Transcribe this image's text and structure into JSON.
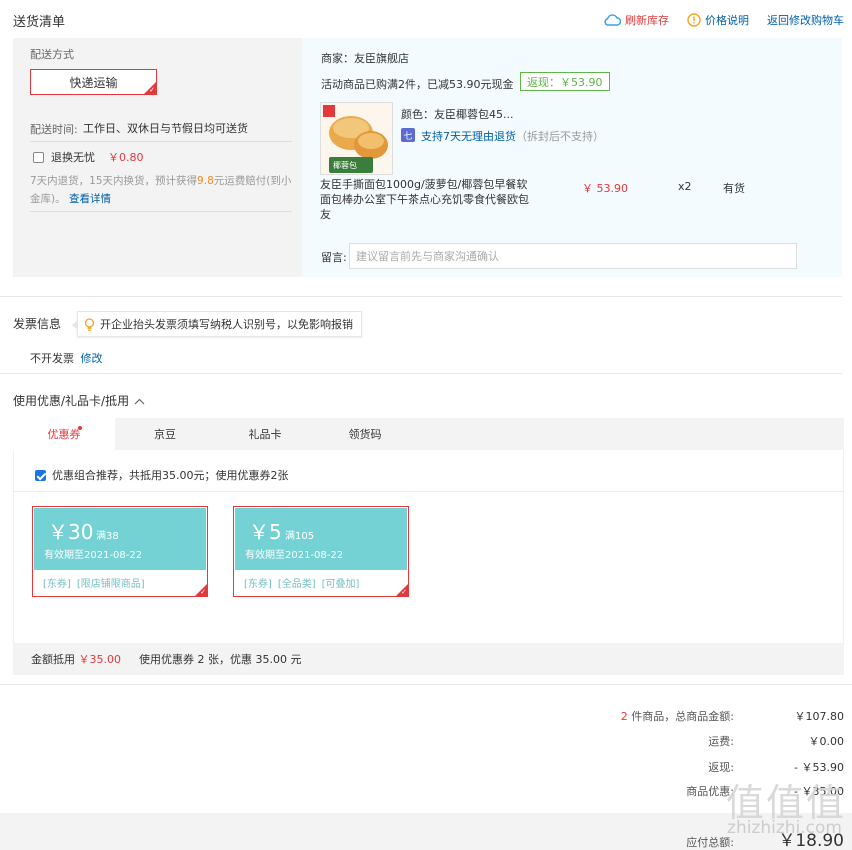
{
  "header": {
    "title": "送货清单",
    "links": [
      {
        "label": "刷新库存",
        "color": "#e4393c",
        "icon": "cloud-refresh-icon"
      },
      {
        "label": "价格说明",
        "color": "#005ea7",
        "icon": "info-circle-icon"
      },
      {
        "label": "返回修改购物车",
        "color": "#005ea7"
      }
    ]
  },
  "shipping": {
    "method_label": "配送方式",
    "method_value": "快递运输",
    "time_label": "配送时间:",
    "time_value": "工作日、双休日与节假日均可送货",
    "worry_free": {
      "label": "退换无忧",
      "price": "￥0.80",
      "checked": false,
      "desc_1": "7天内退货，15天内换货，预计获得",
      "desc_amount": "9.8",
      "desc_2": "元运费赔付(到小金库)。",
      "detail_link": "查看详情"
    }
  },
  "seller": {
    "shop": "商家：友臣旗舰店",
    "promo": "活动商品已购满2件，已减53.90元现金",
    "cashback": "返现：￥53.90",
    "product": {
      "color": "颜色：友臣椰蓉包45...",
      "return_policy": "支持7天无理由退货",
      "return_note": "（拆封后不支持）",
      "title": "友臣手撕面包1000g/菠萝包/椰蓉包早餐软面包棒办公室下午茶点心充饥零食代餐欧包 友",
      "price": "￥ 53.90",
      "qty": "x2",
      "stock": "有货",
      "img_label": "椰蓉包"
    },
    "memo_label": "留言:",
    "memo_placeholder": "建议留言前先与商家沟通确认"
  },
  "invoice": {
    "title": "发票信息",
    "tip": "开企业抬头发票须填写纳税人识别号，以免影响报销",
    "value": "不开发票",
    "edit": "修改"
  },
  "coupons": {
    "title": "使用优惠/礼品卡/抵用",
    "tabs": [
      "优惠券",
      "京豆",
      "礼品卡",
      "领货码"
    ],
    "recommend": "优惠组合推荐，共抵用35.00元；使用优惠券2张",
    "items": [
      {
        "amount": "￥30",
        "cond": "满38",
        "valid": "有效期至2021-08-22",
        "tags": [
          "[东券]",
          "[限店铺限商品]"
        ]
      },
      {
        "amount": "￥5",
        "cond": "满105",
        "valid": "有效期至2021-08-22",
        "tags": [
          "[东券]",
          "[全品类]",
          "[可叠加]"
        ]
      }
    ],
    "footer_label": "金额抵用",
    "footer_amount": "￥35.00",
    "footer_summary": "使用优惠券 2 张，优惠 35.00 元"
  },
  "totals": {
    "count": "2",
    "goods_label": "件商品，总商品金额:",
    "goods_amount": "￥107.80",
    "freight_label": "运费:",
    "freight_amount": "￥0.00",
    "cashback_label": "返现:",
    "cashback_amount": "- ￥53.90",
    "discount_label": "商品优惠:",
    "discount_amount": "- ￥35.00",
    "payable_label": "应付总额:",
    "payable_amount": "￥18.90"
  },
  "watermark": {
    "main": "值值值",
    "sub": "zhizhizhi.com"
  }
}
